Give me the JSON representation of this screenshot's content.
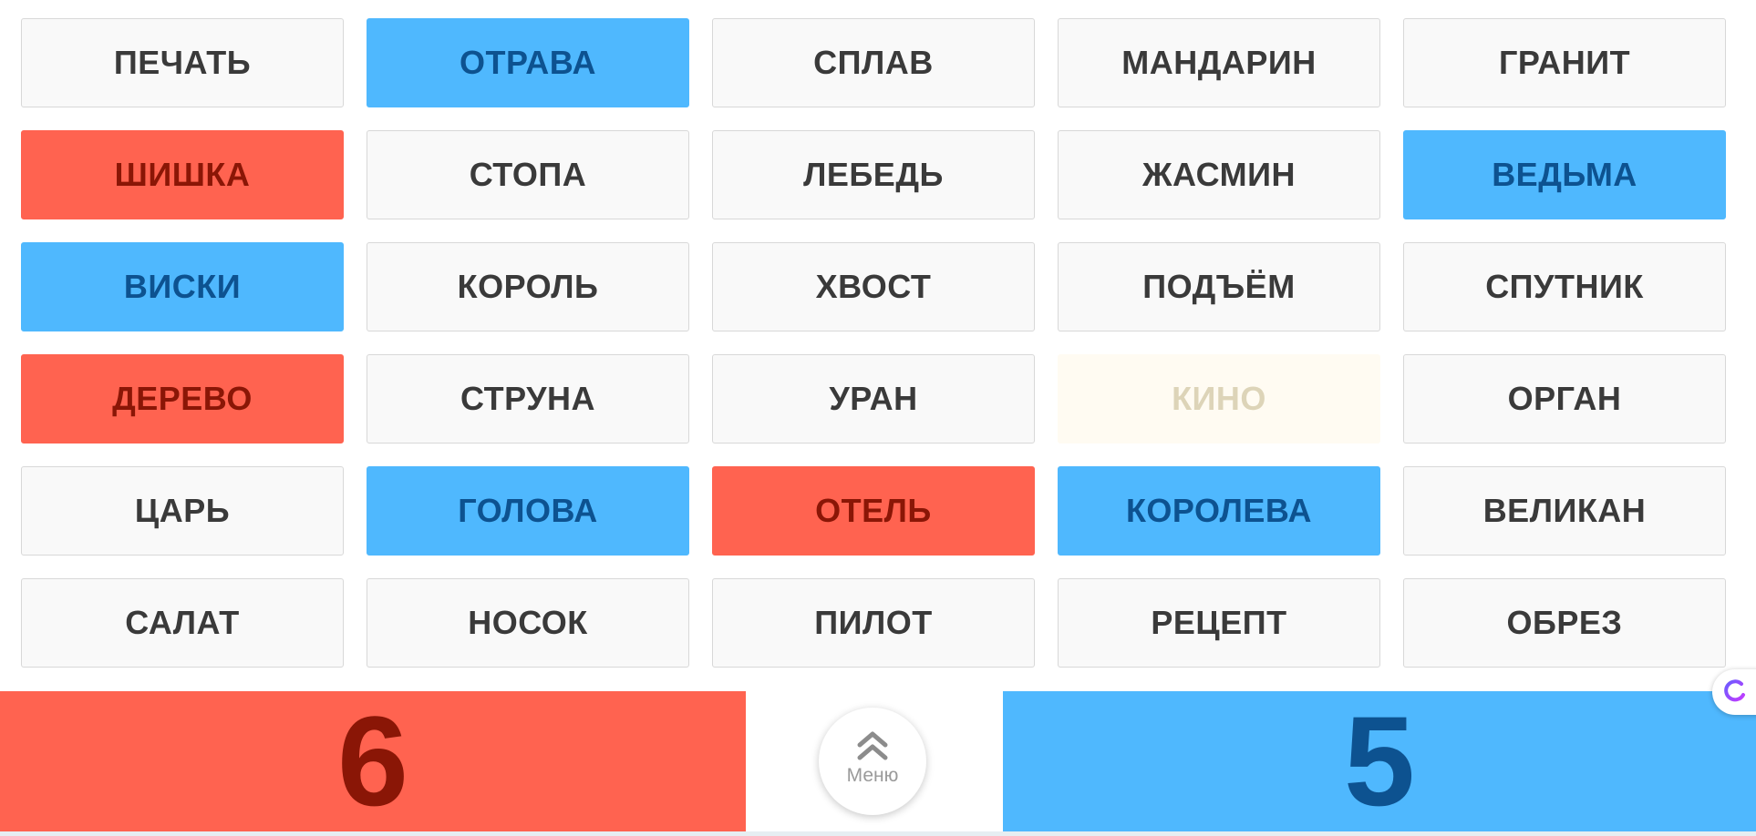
{
  "board": {
    "cards": [
      {
        "word": "ПЕЧАТЬ",
        "state": "hidden"
      },
      {
        "word": "ОТРАВА",
        "state": "blue"
      },
      {
        "word": "СПЛАВ",
        "state": "hidden"
      },
      {
        "word": "МАНДАРИН",
        "state": "hidden"
      },
      {
        "word": "ГРАНИТ",
        "state": "hidden"
      },
      {
        "word": "ШИШКА",
        "state": "red"
      },
      {
        "word": "СТОПА",
        "state": "hidden"
      },
      {
        "word": "ЛЕБЕДЬ",
        "state": "hidden"
      },
      {
        "word": "ЖАСМИН",
        "state": "hidden"
      },
      {
        "word": "ВЕДЬМА",
        "state": "blue"
      },
      {
        "word": "ВИСКИ",
        "state": "blue"
      },
      {
        "word": "КОРОЛЬ",
        "state": "hidden"
      },
      {
        "word": "ХВОСТ",
        "state": "hidden"
      },
      {
        "word": "ПОДЪЁМ",
        "state": "hidden"
      },
      {
        "word": "СПУТНИК",
        "state": "hidden"
      },
      {
        "word": "ДЕРЕВО",
        "state": "red"
      },
      {
        "word": "СТРУНА",
        "state": "hidden"
      },
      {
        "word": "УРАН",
        "state": "hidden"
      },
      {
        "word": "КИНО",
        "state": "neutral"
      },
      {
        "word": "ОРГАН",
        "state": "hidden"
      },
      {
        "word": "ЦАРЬ",
        "state": "hidden"
      },
      {
        "word": "ГОЛОВА",
        "state": "blue"
      },
      {
        "word": "ОТЕЛЬ",
        "state": "red"
      },
      {
        "word": "КОРОЛЕВА",
        "state": "blue"
      },
      {
        "word": "ВЕЛИКАН",
        "state": "hidden"
      },
      {
        "word": "САЛАТ",
        "state": "hidden"
      },
      {
        "word": "НОСОК",
        "state": "hidden"
      },
      {
        "word": "ПИЛОТ",
        "state": "hidden"
      },
      {
        "word": "РЕЦЕПТ",
        "state": "hidden"
      },
      {
        "word": "ОБРЕЗ",
        "state": "hidden"
      }
    ]
  },
  "scoreboard": {
    "red_score": "6",
    "blue_score": "5",
    "menu_label": "Меню",
    "menu_icon": "double-chevron-up-icon"
  },
  "colors": {
    "red": "#ff6350",
    "red_text": "#8a1606",
    "blue": "#4fb8fe",
    "blue_text": "#0d5290",
    "neutral": "#fffbf2",
    "neutral_text": "#ddd4b8",
    "hidden": "#f9f9f9",
    "hidden_text": "#3a3a3a"
  }
}
